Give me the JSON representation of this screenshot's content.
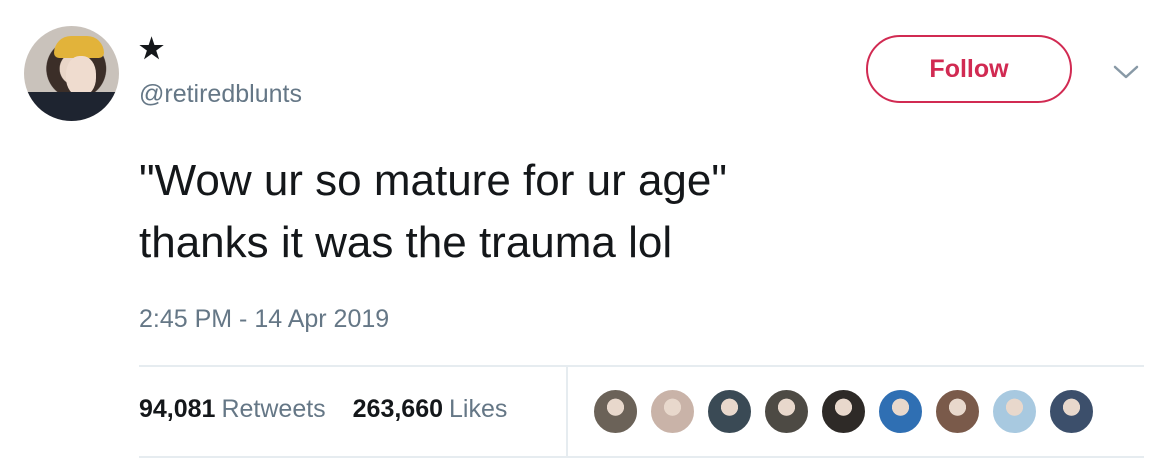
{
  "author": {
    "display_name": "★",
    "handle": "@retiredblunts"
  },
  "actions": {
    "follow_label": "Follow"
  },
  "tweet": {
    "lines": [
      "\"Wow ur so mature for ur age\"",
      "thanks it was the trauma lol"
    ],
    "timestamp": "2:45 PM - 14 Apr 2019"
  },
  "stats": {
    "retweets_count": "94,081",
    "retweets_label": "Retweets",
    "likes_count": "263,660",
    "likes_label": "Likes"
  },
  "liker_avatars": [
    {
      "color": "#6b6258"
    },
    {
      "color": "#c9b3a8"
    },
    {
      "color": "#3a4a55"
    },
    {
      "color": "#4d4a44"
    },
    {
      "color": "#2e2a27"
    },
    {
      "color": "#2f6fb3"
    },
    {
      "color": "#7a5a4a"
    },
    {
      "color": "#a8c9e0"
    },
    {
      "color": "#3c4f6b"
    }
  ],
  "colors": {
    "accent": "#d12a52",
    "secondary_text": "#657786",
    "primary_text": "#14171a"
  }
}
